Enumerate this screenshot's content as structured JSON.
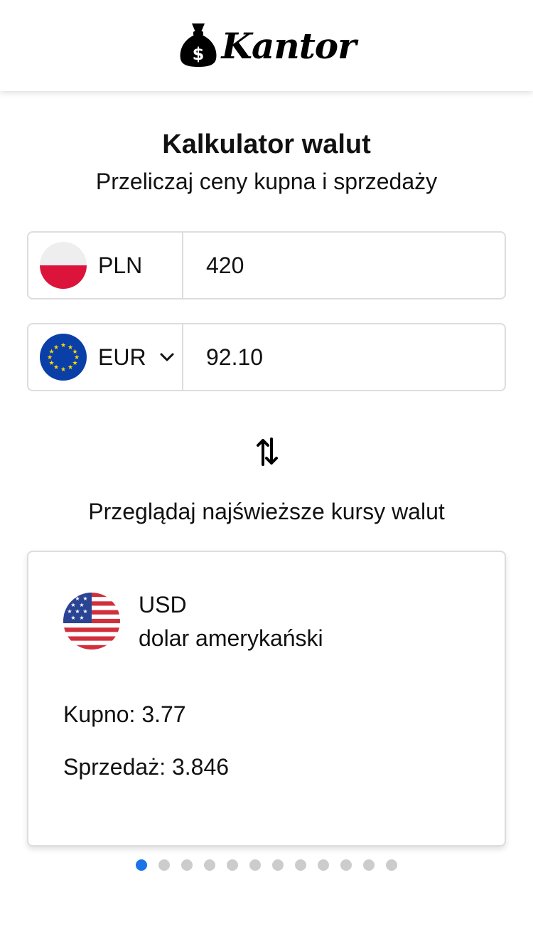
{
  "app": {
    "logo_text": "Kantor"
  },
  "calculator": {
    "title": "Kalkulator walut",
    "subtitle": "Przeliczaj ceny kupna i sprzedaży",
    "from": {
      "code": "PLN",
      "flag_icon": "poland-flag-icon",
      "value": "420"
    },
    "to": {
      "code": "EUR",
      "flag_icon": "eu-flag-icon",
      "value": "92.10"
    },
    "swap_icon": "swap-arrows-icon"
  },
  "rates": {
    "heading": "Przeglądaj najświeższe kursy walut",
    "card": {
      "code": "USD",
      "name": "dolar amerykański",
      "buy": "Kupno: 3.77",
      "sell": "Sprzedaż: 3.846",
      "flag_icon": "usa-flag-icon"
    },
    "pagination": {
      "total": 12,
      "active_index": 0
    }
  },
  "colors": {
    "accent": "#1a73e8",
    "border": "#dddddd",
    "dot_inactive": "#cccccc",
    "poland_red": "#dc143c",
    "eu_blue": "#0a3fa8",
    "eu_star": "#ffd700"
  }
}
